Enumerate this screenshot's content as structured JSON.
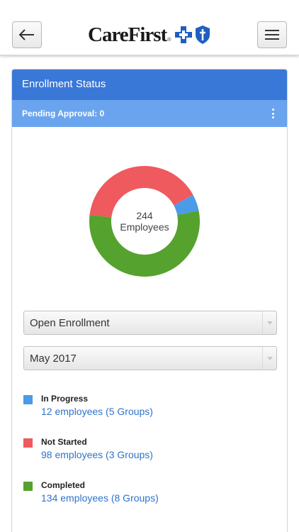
{
  "header": {
    "logo_text": "CareFirst",
    "logo_tm": "®",
    "back_icon": "back-arrow-icon",
    "menu_icon": "hamburger-menu-icon"
  },
  "card": {
    "title": "Enrollment Status",
    "pending_label": "Pending Approval: 0",
    "more_icon": "kebab-menu-icon"
  },
  "donut": {
    "total": "244",
    "unit": "Employees"
  },
  "filters": {
    "enrollment_type": "Open Enrollment",
    "period": "May 2017"
  },
  "legend": [
    {
      "label": "In Progress",
      "detail": "12 employees (5 Groups)",
      "color": "#4c9be6"
    },
    {
      "label": "Not Started",
      "detail": "98 employees (3 Groups)",
      "color": "#ee5a5e"
    },
    {
      "label": "Completed",
      "detail": "134 employees (8 Groups)",
      "color": "#55a22e"
    }
  ],
  "chart_data": {
    "type": "pie",
    "categories": [
      "In Progress",
      "Not Started",
      "Completed"
    ],
    "values": [
      12,
      98,
      134
    ],
    "colors": [
      "#4c9be6",
      "#ee5a5e",
      "#55a22e"
    ]
  },
  "colors": {
    "header_blue": "#3a78d8",
    "subheader_blue": "#6aa4ee",
    "link_blue": "#2f74c9"
  }
}
